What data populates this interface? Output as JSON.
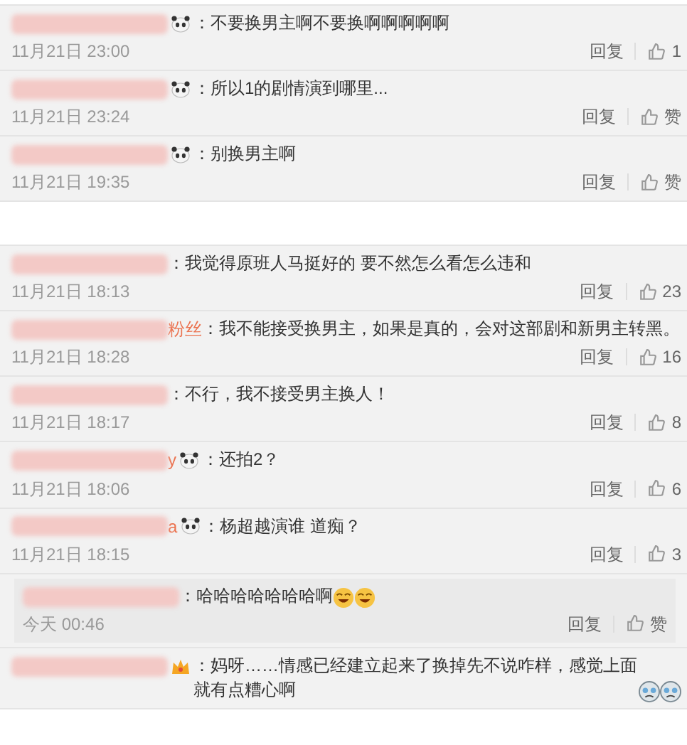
{
  "groups": [
    {
      "comments": [
        {
          "kind": "comment",
          "badge": {
            "kind": "panda"
          },
          "text": "：不要换男主啊不要换啊啊啊啊啊",
          "date": "11月21日 23:00",
          "reply": "回复",
          "likes": "1"
        },
        {
          "kind": "comment",
          "badge": {
            "kind": "panda"
          },
          "text": "：所以1的剧情演到哪里...",
          "date": "11月21日 23:24",
          "reply": "回复",
          "likes": "赞"
        },
        {
          "kind": "comment",
          "badge": {
            "kind": "panda"
          },
          "text": "：别换男主啊",
          "date": "11月21日 19:35",
          "reply": "回复",
          "likes": "赞"
        }
      ]
    },
    {
      "comments": [
        {
          "kind": "comment",
          "text": "：我觉得原班人马挺好的 要不然怎么看怎么违和",
          "date": "11月21日 18:13",
          "reply": "回复",
          "likes": "23"
        },
        {
          "kind": "comment",
          "name_visible": "粉丝",
          "text": "：我不能接受换男主，如果是真的，会对这部剧和新男主转黑。",
          "date": "11月21日 18:28",
          "reply": "回复",
          "likes": "16"
        },
        {
          "kind": "comment",
          "text": "：不行，我不接受男主换人！",
          "date": "11月21日 18:17",
          "reply": "回复",
          "likes": "8"
        },
        {
          "kind": "comment",
          "name_visible": "y",
          "badge": {
            "kind": "panda"
          },
          "text": "：还拍2？",
          "date": "11月21日 18:06",
          "reply": "回复",
          "likes": "6"
        },
        {
          "kind": "comment",
          "name_visible": "a",
          "badge": {
            "kind": "panda"
          },
          "text": "：杨超越演谁 道痴？",
          "date": "11月21日 18:15",
          "reply": "回复",
          "likes": "3"
        },
        {
          "kind": "reply",
          "text": "：哈哈哈哈哈哈哈啊",
          "trailing": [
            {
              "kind": "laugh"
            },
            {
              "kind": "laugh"
            }
          ],
          "date": "今天 00:46",
          "reply": "回复",
          "likes": "赞"
        },
        {
          "kind": "comment",
          "badge": {
            "kind": "crown"
          },
          "text": "：妈呀……情感已经建立起来了换掉先不说咋样，感觉上面就有点糟心啊",
          "trailing": [
            {
              "kind": "cry"
            },
            {
              "kind": "cry"
            }
          ]
        }
      ]
    }
  ]
}
